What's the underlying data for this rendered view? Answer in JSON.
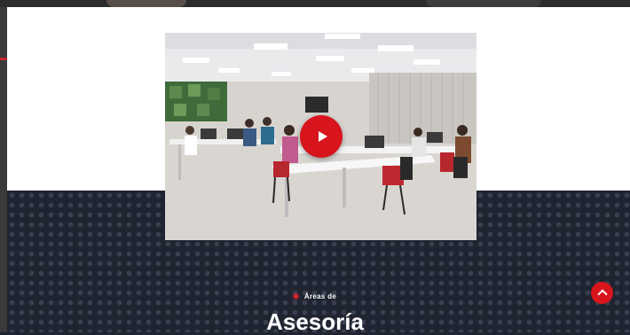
{
  "section": {
    "eyebrow": "Áreas de",
    "heading": "Asesoría"
  },
  "video": {
    "play_icon": "play-icon",
    "thumbnail_subject": "office workspace with people at desks"
  },
  "controls": {
    "scroll_top_icon": "chevron-up-icon"
  },
  "colors": {
    "accent": "#d8141d",
    "dark_bg": "#1f2430",
    "panel_bg": "#ffffff"
  }
}
